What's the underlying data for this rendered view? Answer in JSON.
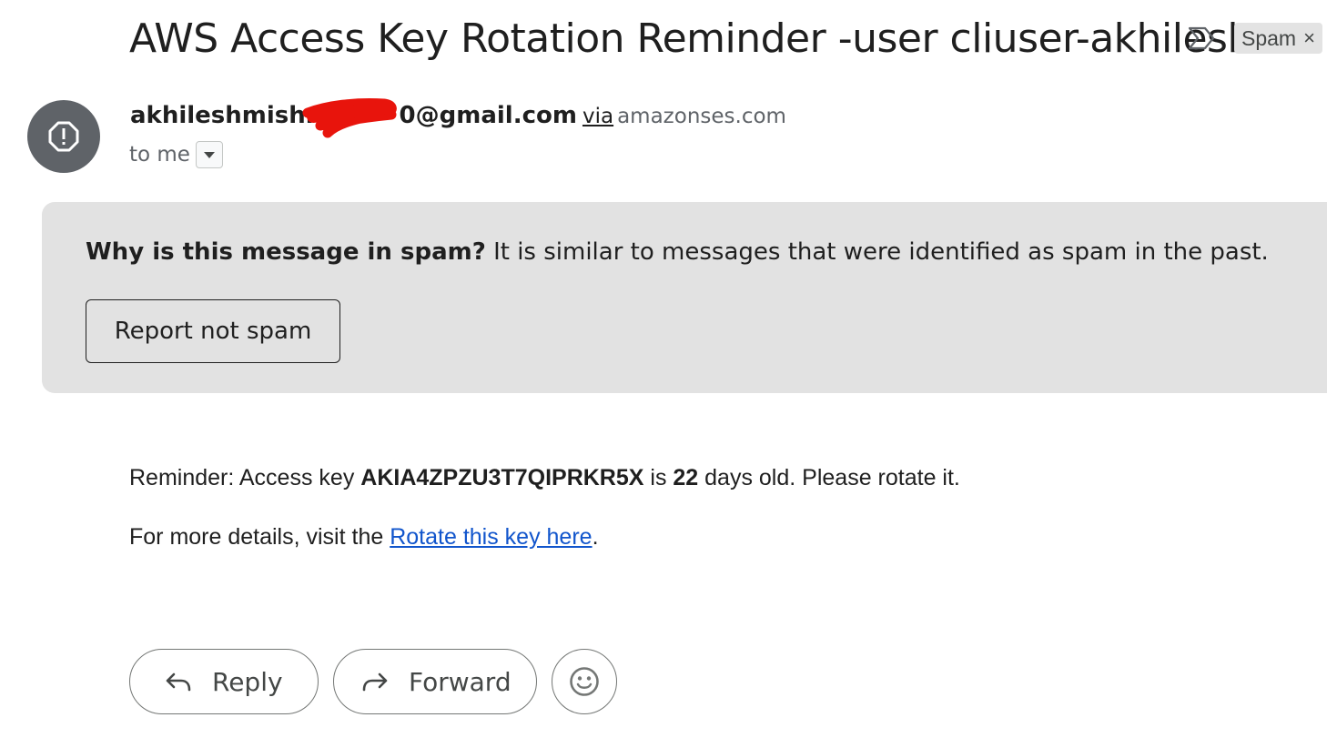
{
  "email": {
    "subject": "AWS Access Key Rotation Reminder -user cliuser-akhilesh",
    "label_chip": "Spam",
    "label_chip_close": "×",
    "sender_address": "akhileshmishra        0@gmail.com",
    "via": "via",
    "via_domain": "amazonses.com",
    "recipient": "to me"
  },
  "spam_banner": {
    "question": "Why is this message in spam?",
    "explanation": " It is similar to messages that were identified as spam in the past.",
    "button": "Report not spam"
  },
  "body": {
    "line1_prefix": "Reminder: Access key ",
    "access_key": "AKIA4ZPZU3T7QIPRKR5X",
    "line1_mid": " is ",
    "days": "22",
    "line1_suffix": " days old. Please rotate it.",
    "line2_prefix": "For more details, visit the ",
    "link_text": "Rotate this key here",
    "line2_suffix": "."
  },
  "actions": {
    "reply": "Reply",
    "forward": "Forward"
  },
  "icons": [
    "important-label-icon",
    "warning-icon",
    "chevron-down-icon",
    "reply-icon",
    "forward-icon",
    "emoji-icon"
  ]
}
